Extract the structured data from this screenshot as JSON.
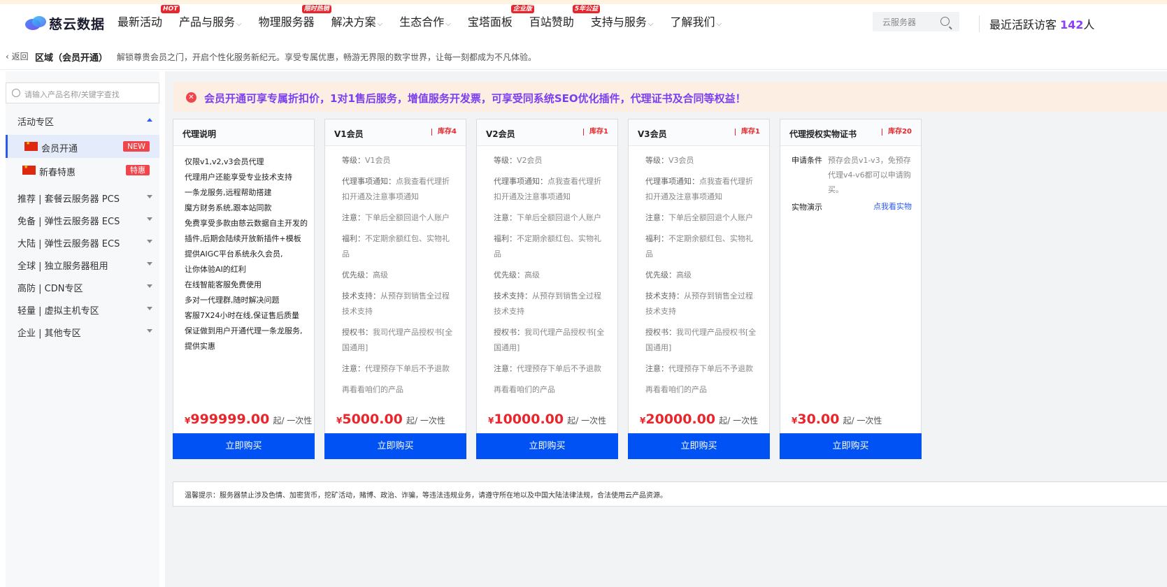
{
  "header": {
    "logo_text": "慈云数据",
    "nav": [
      {
        "label": "最新活动",
        "badge": "HOT",
        "chevron": false
      },
      {
        "label": "产品与服务",
        "badge": "",
        "chevron": true
      },
      {
        "label": "物理服务器",
        "badge": "限时热销",
        "chevron": false
      },
      {
        "label": "解决方案",
        "badge": "",
        "chevron": true
      },
      {
        "label": "生态合作",
        "badge": "",
        "chevron": true
      },
      {
        "label": "宝塔面板",
        "badge": "企业版",
        "chevron": false
      },
      {
        "label": "百站赞助",
        "badge": "5年公益",
        "chevron": false
      },
      {
        "label": "支持与服务",
        "badge": "",
        "chevron": true
      },
      {
        "label": "了解我们",
        "badge": "",
        "chevron": true
      }
    ],
    "search_placeholder": "云服务器",
    "visitors_label": "最近活跃访客",
    "visitors_count": "142",
    "visitors_unit": "人"
  },
  "breadcrumb": {
    "back": "返回",
    "title": "区域（会员开通）",
    "desc": "解锁尊贵会员之门，开启个性化服务新纪元。享受专属优惠，畅游无界限的数字世界，让每一刻都成为不凡体验。"
  },
  "sidebar": {
    "search_placeholder": "请输入产品名称/关键字查找",
    "active_group": "活动专区",
    "items": [
      {
        "label": "会员开通",
        "tag": "NEW"
      },
      {
        "label": "新春特惠",
        "tag": "特惠"
      }
    ],
    "groups": [
      "推荐 | 套餐云服务器 PCS",
      "免备 | 弹性云服务器 ECS",
      "大陆 | 弹性云服务器 ECS",
      "全球 | 独立服务器租用",
      "高防 | CDN专区",
      "轻量 | 虚拟主机专区",
      "企业 | 其他专区"
    ]
  },
  "notice": "会员开通可享专属折扣价，1对1售后服务，增值服务开发票，可享受同系统SEO优化插件，代理证书及合同等权益！",
  "cards": {
    "agent_info": {
      "title": "代理说明",
      "lines": [
        "仅限v1,v2,v3会员代理",
        "代理用户还能享受专业技术支持",
        "一条龙服务,远程帮助搭建",
        "魔方财务系统,跟本站同款",
        "免费享受多款由慈云数据自主开发的",
        "插件,后期会陆续开放新插件+模板",
        "提供AIGC平台系统永久会员,",
        "让你体验AI的红利",
        "在线智能客服免费使用",
        "多对一代理群,随时解决问题",
        "客服7X24小时在线,保证售后质量",
        "保证做到用户开通代理一条龙服务,",
        "提供实惠"
      ],
      "price": "999999.00",
      "buy": "立即购买"
    },
    "members": [
      {
        "title": "V1会员",
        "stock": "库存4",
        "level": "V1会员",
        "price": "5000.00"
      },
      {
        "title": "V2会员",
        "stock": "库存1",
        "level": "V2会员",
        "price": "10000.00"
      },
      {
        "title": "V3会员",
        "stock": "库存1",
        "level": "V3会员",
        "price": "20000.00"
      }
    ],
    "member_rows": {
      "level_k": "等级：",
      "notice_k": "代理事项通知：",
      "notice_v": "点我查看代理折扣开通及注意事项通知",
      "attn_k": "注意：",
      "attn_v": "下单后全额回退个人账户",
      "welfare_k": "福利：",
      "welfare_v": "不定期余额红包、实物礼品",
      "priority_k": "优先级：",
      "priority_v": "高级",
      "tech_k": "技术支持：",
      "tech_v": "从预存到销售全过程技术支持",
      "cert_k": "授权书：",
      "cert_v": "我司代理产品授权书[全国通用]",
      "attn2_k": "注意：",
      "attn2_v": "代理预存下单后不予退款",
      "more": "再看看咱们的产品"
    },
    "cert": {
      "title": "代理授权实物证书",
      "stock": "库存20",
      "cond_k": "申请条件",
      "cond_v": "预存会员v1-v3，免预存代理v4-v6都可以申请购买。",
      "demo_k": "实物演示",
      "demo_v": "点我看实物",
      "price": "30.00"
    },
    "currency": "¥",
    "unit": "起/ 一次性",
    "buy": "立即购买"
  },
  "tip": "温馨提示：服务器禁止涉及色情、加密货币，挖矿活动，赌博、政治、诈骗，等违法违规业务，请遵守所在地以及中国大陆法律法规，合法使用云产品资源。",
  "colors": {
    "primary": "#0052f5",
    "price": "#e8262b",
    "notice": "#7a3ff0"
  }
}
